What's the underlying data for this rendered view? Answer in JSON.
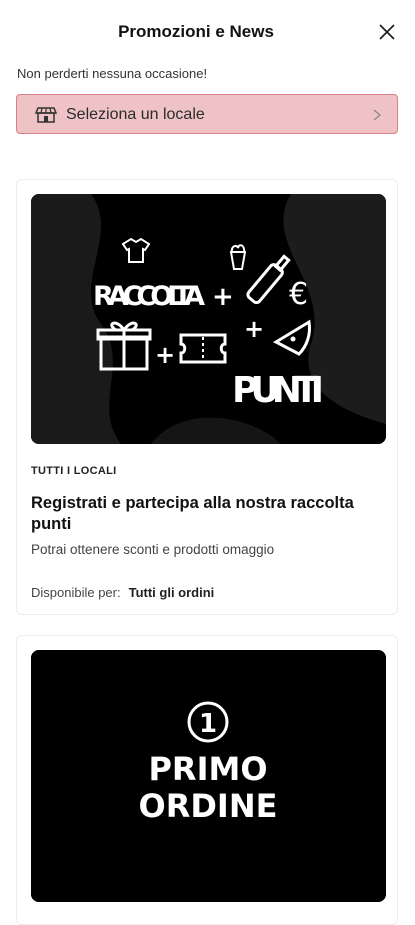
{
  "header": {
    "title": "Promozioni e News"
  },
  "subtitle": "Non perderti nessuna occasione!",
  "locale_selector": {
    "label": "Seleziona un locale",
    "icon": "store-icon"
  },
  "promotions": [
    {
      "banner_words": [
        "RACCOLTA",
        "PUNTI"
      ],
      "tag": "TUTTI I LOCALI",
      "title": "Registrati e partecipa alla nostra raccolta punti",
      "description": "Potrai ottenere sconti e prodotti omaggio",
      "availability_label": "Disponibile per:",
      "availability_value": "Tutti gli ordini"
    },
    {
      "banner_number": "1",
      "banner_words": [
        "PRIMO",
        "ORDINE"
      ]
    }
  ],
  "colors": {
    "selector_bg": "#efc3c6",
    "selector_border": "#d98089",
    "banner_bg": "#000000"
  }
}
